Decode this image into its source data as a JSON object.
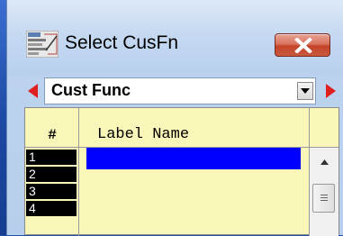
{
  "window": {
    "title": "Select CusFn",
    "icon": "cusfn-app-icon"
  },
  "toolbar": {
    "prev_icon": "red-left-arrow-icon",
    "next_icon": "red-right-arrow-icon",
    "combo_value": "Cust Func"
  },
  "grid": {
    "columns": [
      "#",
      "Label Name"
    ],
    "rows": [
      {
        "num": "1",
        "label": "",
        "selected": true
      },
      {
        "num": "2",
        "label": ""
      },
      {
        "num": "3",
        "label": ""
      },
      {
        "num": "4",
        "label": ""
      }
    ]
  },
  "colors": {
    "grid_background": "#f8f6b8",
    "selection": "#0000ff",
    "nav_arrow": "#e02020",
    "close_button": "#c4422a"
  }
}
